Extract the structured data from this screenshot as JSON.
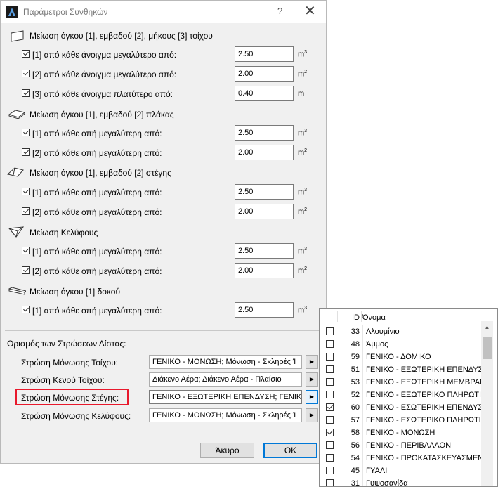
{
  "window": {
    "title": "Παράμετροι Συνθηκών",
    "help": "?",
    "close": "✕"
  },
  "sections": [
    {
      "title": "Μείωση όγκου [1], εμβαδού [2], μήκους [3] τοίχου",
      "icon": "wall-icon",
      "rows": [
        {
          "label": "[1] από κάθε άνοιγμα μεγαλύτερο από:",
          "checked": true,
          "value": "2.50",
          "unit": "m",
          "sup": "3"
        },
        {
          "label": "[2] από κάθε άνοιγμα μεγαλύτερο από:",
          "checked": true,
          "value": "2.00",
          "unit": "m",
          "sup": "2"
        },
        {
          "label": "[3] από κάθε άνοιγμα πλατύτερο από:",
          "checked": true,
          "value": "0.40",
          "unit": "m",
          "sup": ""
        }
      ]
    },
    {
      "title": "Μείωση όγκου [1], εμβαδού [2] πλάκας",
      "icon": "slab-icon",
      "rows": [
        {
          "label": "[1] από κάθε οπή μεγαλύτερη από:",
          "checked": true,
          "value": "2.50",
          "unit": "m",
          "sup": "3"
        },
        {
          "label": "[2] από κάθε οπή μεγαλύτερη από:",
          "checked": true,
          "value": "2.00",
          "unit": "m",
          "sup": "2"
        }
      ]
    },
    {
      "title": "Μείωση όγκου [1], εμβαδού [2] στέγης",
      "icon": "roof-icon",
      "rows": [
        {
          "label": "[1] από κάθε οπή μεγαλύτερη από:",
          "checked": true,
          "value": "2.50",
          "unit": "m",
          "sup": "3"
        },
        {
          "label": "[2] από κάθε οπή μεγαλύτερη από:",
          "checked": true,
          "value": "2.00",
          "unit": "m",
          "sup": "2"
        }
      ]
    },
    {
      "title": "Μείωση Κελύφους",
      "icon": "shell-icon",
      "rows": [
        {
          "label": "[1] από κάθε οπή μεγαλύτερη από:",
          "checked": true,
          "value": "2.50",
          "unit": "m",
          "sup": "3"
        },
        {
          "label": "[2] από κάθε οπή μεγαλύτερη από:",
          "checked": true,
          "value": "2.00",
          "unit": "m",
          "sup": "2"
        }
      ]
    },
    {
      "title": "Μείωση όγκου [1] δοκού",
      "icon": "beam-icon",
      "rows": [
        {
          "label": "[1] από κάθε οπή μεγαλύτερη από:",
          "checked": true,
          "value": "2.50",
          "unit": "m",
          "sup": "3"
        }
      ]
    }
  ],
  "layers": {
    "title": "Ορισμός των Στρώσεων Λίστας:",
    "fields": [
      {
        "label": "Στρώση Μόνωσης Τοίχου:",
        "value": "ΓΕΝΙΚΟ - ΜΟΝΩΣΗ; Μόνωση - Σκληρές Ί"
      },
      {
        "label": "Στρώση Κενού Τοίχου:",
        "value": "Διάκενο Αέρα; Διάκενο Αέρα - Πλαίσιο"
      },
      {
        "label": "Στρώση Μόνωσης Στέγης:",
        "value": "ΓΕΝΙΚΟ - ΕΞΩΤΕΡΙΚΗ ΕΠΕΝΔΥΣΗ; ΓΕΝΙΚΟ -"
      },
      {
        "label": "Στρώση Μόνωσης Κελύφους:",
        "value": "ΓΕΝΙΚΟ - ΜΟΝΩΣΗ; Μόνωση - Σκληρές Ί"
      }
    ],
    "arrow": "▶"
  },
  "buttons": {
    "cancel": "Άκυρο",
    "ok": "OK"
  },
  "popup": {
    "headers": {
      "id": "ID",
      "name": "Όνομα"
    },
    "scroll_up": "▲",
    "items": [
      {
        "id": "33",
        "name": "Αλουμίνιο",
        "checked": false
      },
      {
        "id": "48",
        "name": "Άμμος",
        "checked": false
      },
      {
        "id": "59",
        "name": "ΓΕΝΙΚΟ - ΔΟΜΙΚΟ",
        "checked": false
      },
      {
        "id": "51",
        "name": "ΓΕΝΙΚΟ - ΕΞΩΤΕΡΙΚΗ ΕΠΕΝΔΥΣΗ",
        "checked": false
      },
      {
        "id": "53",
        "name": "ΓΕΝΙΚΟ - ΕΞΩΤΕΡΙΚΗ ΜΕΜΒΡΑΝΗ",
        "checked": false
      },
      {
        "id": "52",
        "name": "ΓΕΝΙΚΟ - ΕΞΩΤΕΡΙΚΟ ΠΛΗΡΩΤΙΚΟ",
        "checked": false
      },
      {
        "id": "60",
        "name": "ΓΕΝΙΚΟ - ΕΣΩΤΕΡΙΚΗ ΕΠΕΝΔΥΣΗ",
        "checked": true
      },
      {
        "id": "57",
        "name": "ΓΕΝΙΚΟ - ΕΣΩΤΕΡΙΚΟ ΠΛΗΡΩΤΙΚΟ",
        "checked": false
      },
      {
        "id": "58",
        "name": "ΓΕΝΙΚΟ - ΜΟΝΩΣΗ",
        "checked": true
      },
      {
        "id": "56",
        "name": "ΓΕΝΙΚΟ - ΠΕΡΙΒΑΛΛΟΝ",
        "checked": false
      },
      {
        "id": "54",
        "name": "ΓΕΝΙΚΟ - ΠΡΟΚΑΤΑΣΚΕΥΑΣΜΕΝΟ",
        "checked": false
      },
      {
        "id": "45",
        "name": "ΓΥΑΛΙ",
        "checked": false
      },
      {
        "id": "31",
        "name": "Γυψοσανίδα",
        "checked": false
      }
    ]
  }
}
